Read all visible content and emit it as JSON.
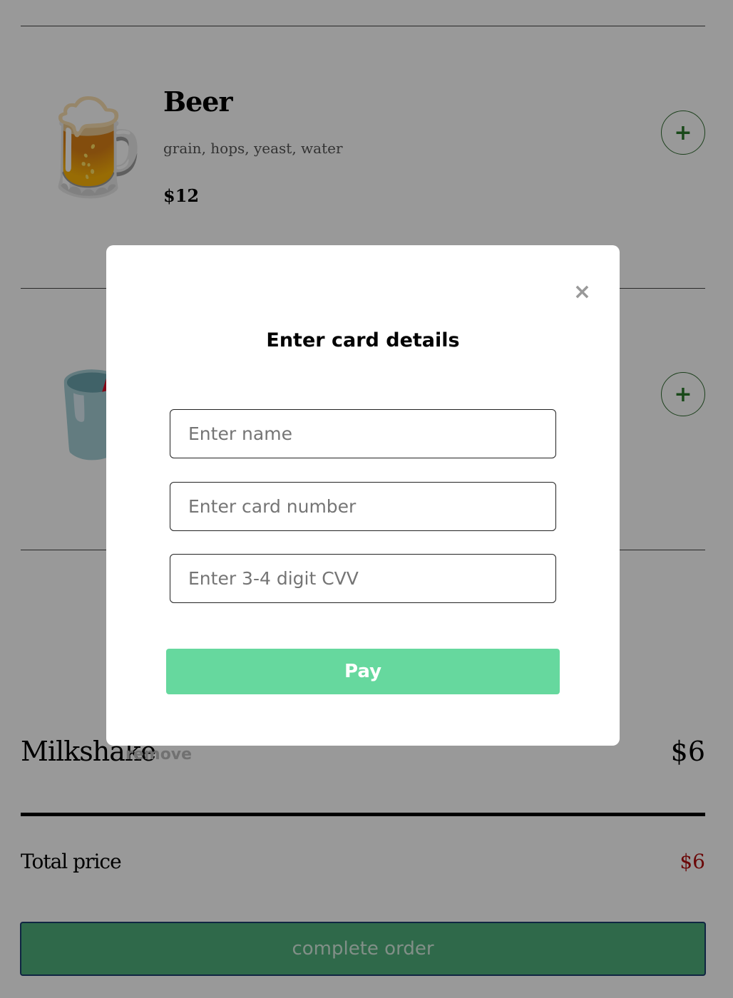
{
  "menu": {
    "items": [
      {
        "emoji": "🍺",
        "icon": "beer-mug-icon",
        "name": "Beer",
        "ingredients": "grain, hops, yeast, water",
        "price": "$12",
        "add_label": "+"
      },
      {
        "emoji": "🥤",
        "icon": "cup-with-straw-icon",
        "name": "",
        "ingredients": "",
        "price": "",
        "add_label": "+"
      }
    ]
  },
  "order": {
    "lines": [
      {
        "name": "Milkshake",
        "remove_label": "remove",
        "price": "$6"
      }
    ],
    "total_label": "Total price",
    "total_price": "$6",
    "complete_label": "complete order"
  },
  "modal": {
    "close_label": "×",
    "title": "Enter card details",
    "name_placeholder": "Enter name",
    "card_placeholder": "Enter card number",
    "cvv_placeholder": "Enter 3-4 digit CVV",
    "pay_label": "Pay"
  },
  "colors": {
    "pay_button": "#66d89e",
    "complete_button": "#4fb07c",
    "total_price": "#b31010",
    "add_button": "#2a7a2a"
  }
}
